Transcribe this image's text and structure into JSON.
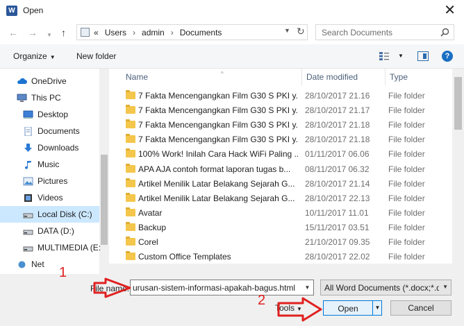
{
  "window": {
    "title": "Open",
    "app_icon_letter": "W"
  },
  "address": {
    "path": [
      "«",
      "Users",
      "admin",
      "Documents"
    ]
  },
  "search": {
    "placeholder": "Search Documents"
  },
  "toolbar": {
    "organize": "Organize",
    "new_folder": "New folder",
    "help": "?"
  },
  "sidebar": {
    "items": [
      {
        "label": "OneDrive",
        "icon": "cloud-icon",
        "indent": 0
      },
      {
        "label": "This PC",
        "icon": "computer-icon",
        "indent": 0
      },
      {
        "label": "Desktop",
        "icon": "desktop-icon",
        "indent": 1
      },
      {
        "label": "Documents",
        "icon": "documents-icon",
        "indent": 1
      },
      {
        "label": "Downloads",
        "icon": "download-icon",
        "indent": 1
      },
      {
        "label": "Music",
        "icon": "music-icon",
        "indent": 1
      },
      {
        "label": "Pictures",
        "icon": "pictures-icon",
        "indent": 1
      },
      {
        "label": "Videos",
        "icon": "video-icon",
        "indent": 1
      },
      {
        "label": "Local Disk (C:)",
        "icon": "drive-icon",
        "indent": 1,
        "selected": true
      },
      {
        "label": "DATA (D:)",
        "icon": "drive-icon",
        "indent": 1
      },
      {
        "label": "MULTIMEDIA (E:",
        "icon": "drive-icon",
        "indent": 1
      },
      {
        "label": "Net",
        "icon": "network-icon",
        "indent": 0
      }
    ]
  },
  "columns": {
    "name": "Name",
    "date": "Date modified",
    "type": "Type"
  },
  "files": [
    {
      "name": "7 Fakta Mencengangkan Film G30 S PKI y...",
      "date": "28/10/2017 21.16",
      "type": "File folder"
    },
    {
      "name": "7 Fakta Mencengangkan Film G30 S PKI y...",
      "date": "28/10/2017 21.17",
      "type": "File folder"
    },
    {
      "name": "7 Fakta Mencengangkan Film G30 S PKI y...",
      "date": "28/10/2017 21.18",
      "type": "File folder"
    },
    {
      "name": "7 Fakta Mencengangkan Film G30 S PKI y...",
      "date": "28/10/2017 21.18",
      "type": "File folder"
    },
    {
      "name": "100% Work! Inilah Cara Hack WiFi Paling ...",
      "date": "01/11/2017 06.06",
      "type": "File folder"
    },
    {
      "name": "APA AJA   contoh format laporan tugas b...",
      "date": "08/11/2017 06.32",
      "type": "File folder"
    },
    {
      "name": "Artikel   Menilik Latar Belakang Sejarah G...",
      "date": "28/10/2017 21.14",
      "type": "File folder"
    },
    {
      "name": "Artikel   Menilik Latar Belakang Sejarah G...",
      "date": "28/10/2017 22.13",
      "type": "File folder"
    },
    {
      "name": "Avatar",
      "date": "10/11/2017 11.01",
      "type": "File folder"
    },
    {
      "name": "Backup",
      "date": "15/11/2017 03.51",
      "type": "File folder"
    },
    {
      "name": "Corel",
      "date": "21/10/2017 09.35",
      "type": "File folder"
    },
    {
      "name": "Custom Office Templates",
      "date": "28/10/2017 22.02",
      "type": "File folder"
    }
  ],
  "bottom": {
    "file_name_label": "File name:",
    "file_name_value": "urusan-sistem-informasi-apakah-bagus.html",
    "filter_value": "All Word Documents (*.docx;*.docm;*.dotx)",
    "tools_label": "Tools",
    "open_label": "Open",
    "cancel_label": "Cancel"
  },
  "annotations": {
    "step1": "1",
    "step2": "2",
    "color": "#e02020"
  }
}
